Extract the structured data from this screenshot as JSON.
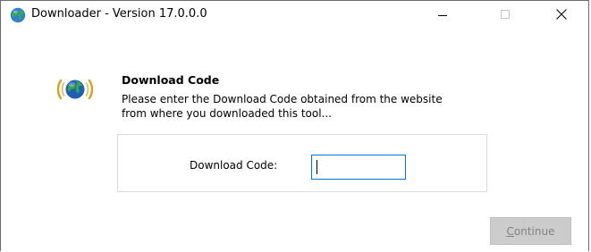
{
  "window": {
    "title": "Downloader - Version 17.0.0.0",
    "icon": "globe-icon",
    "controls": {
      "minimize": "minimize-icon",
      "maximize": "maximize-icon",
      "close": "close-icon"
    }
  },
  "dialog": {
    "heading": "Download Code",
    "description_line1": "Please enter the Download Code obtained from the website",
    "description_line2": "from where you downloaded this tool...",
    "field_label": "Download Code:",
    "field_value": "",
    "continue_mnemonic": "C",
    "continue_rest": "ontinue",
    "continue_enabled": false
  },
  "colors": {
    "input_focus_border": "#0078d7",
    "disabled_button_bg": "#cccccc",
    "disabled_button_text": "#838383"
  }
}
